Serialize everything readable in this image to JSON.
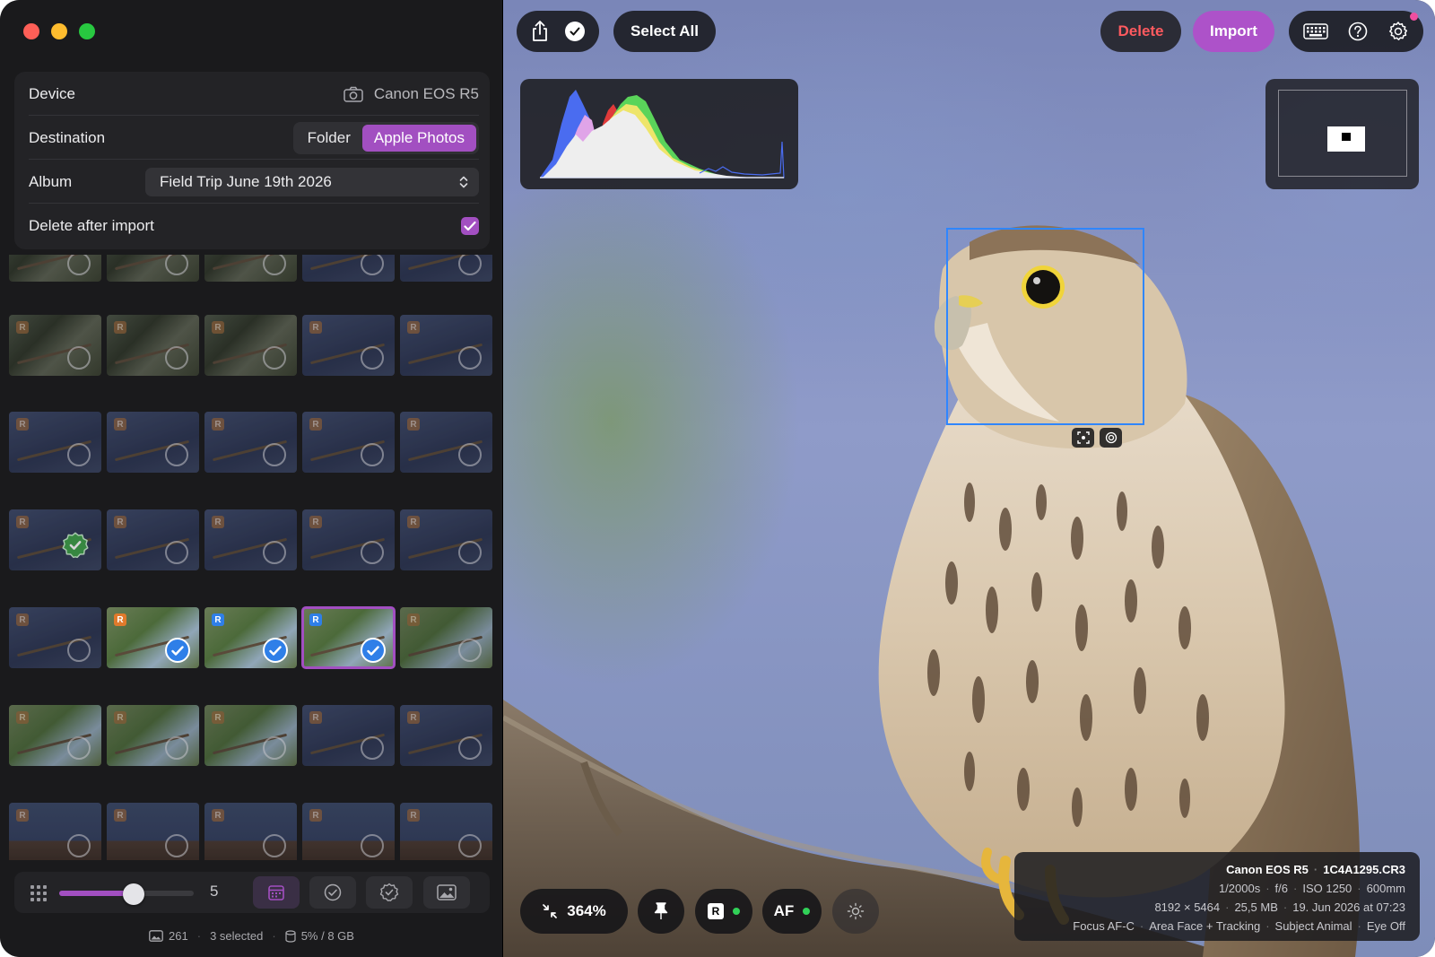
{
  "settings": {
    "device_label": "Device",
    "device_value": "Canon EOS R5",
    "destination_label": "Destination",
    "destination_options": [
      "Folder",
      "Apple Photos"
    ],
    "destination_selected": "Apple Photos",
    "album_label": "Album",
    "album_value": "Field Trip June 19th 2026",
    "delete_after_import_label": "Delete after import",
    "delete_after_import_checked": true
  },
  "thumbnail_grid": {
    "raw_badge": "R",
    "rows": [
      [
        "tree-partial",
        "tree-partial",
        "tree-partial",
        "sky-partial",
        "sky-partial"
      ],
      [
        "tree",
        "tree",
        "tree",
        "sky",
        "sky"
      ],
      [
        "sky",
        "sky",
        "sky",
        "sky",
        "sky"
      ],
      [
        "sky-approved",
        "sky",
        "sky",
        "sky",
        "sky"
      ],
      [
        "sky",
        "leafy-selected",
        "leafy-selected",
        "leafy-selected-current",
        "leafy"
      ],
      [
        "leafy",
        "leafy",
        "leafy",
        "sky",
        "sky"
      ],
      [
        "roof",
        "roof",
        "roof",
        "roof",
        "roof"
      ]
    ]
  },
  "bottom_bar": {
    "grid_size": "5",
    "zoom_level": 0.55,
    "buttons": [
      "calendar-icon",
      "checkmark-circle-icon",
      "seal-check-icon",
      "photo-icon"
    ]
  },
  "status": {
    "photo_count": "261",
    "selected_text": "3 selected",
    "storage_text": "5% / 8 GB"
  },
  "toolbar": {
    "select_all_label": "Select All",
    "delete_label": "Delete",
    "import_label": "Import"
  },
  "viewer_controls": {
    "zoom_text": "364%",
    "af_label": "AF",
    "raw_label": "R"
  },
  "exif": {
    "camera": "Canon EOS R5",
    "filename": "1C4A1295.CR3",
    "shutter": "1/2000s",
    "aperture": "f/6",
    "iso": "ISO 1250",
    "focal_length": "600mm",
    "dimensions": "8192 × 5464",
    "file_size": "25,5 MB",
    "date": "19. Jun 2026 at 07:23",
    "focus_mode": "Focus AF-C",
    "area_mode": "Area Face + Tracking",
    "subject": "Subject Animal",
    "eye": "Eye Off"
  },
  "colors": {
    "accent": "#a24fc1",
    "import_button": "#ad52c9",
    "delete_text": "#ff5a5f",
    "focus_box": "#2f86ff",
    "selection_check": "#2f7fe8"
  }
}
